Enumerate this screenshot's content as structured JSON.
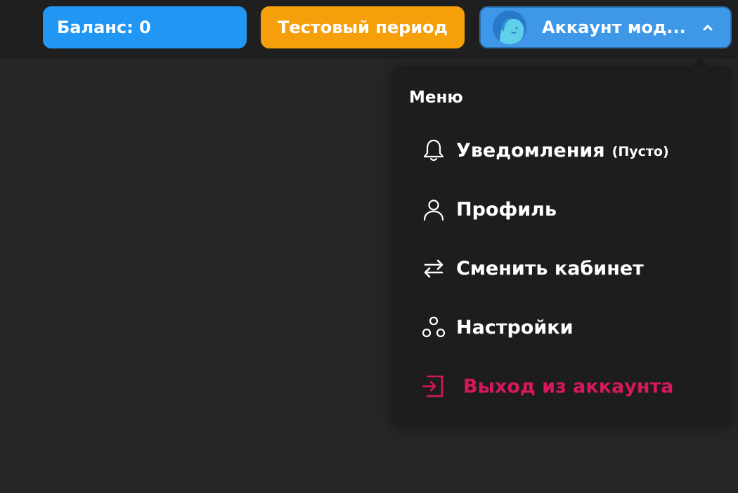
{
  "header": {
    "balance_label": "Баланс: 0",
    "trial_label": "Тестовый период",
    "account_label": "Аккаунт мод...",
    "colors": {
      "balance": "#2196f3",
      "trial": "#f59f0b",
      "account": "#3f97e8"
    }
  },
  "menu": {
    "title": "Меню",
    "items": [
      {
        "icon": "bell-icon",
        "label": "Уведомления",
        "sub": "(Пусто)"
      },
      {
        "icon": "user-icon",
        "label": "Профиль"
      },
      {
        "icon": "swap-arrows-icon",
        "label": "Сменить кабинет"
      },
      {
        "icon": "settings-circles-icon",
        "label": "Настройки"
      },
      {
        "icon": "logout-icon",
        "label": "Выход из аккаунта",
        "color": "#d6185c"
      }
    ]
  }
}
